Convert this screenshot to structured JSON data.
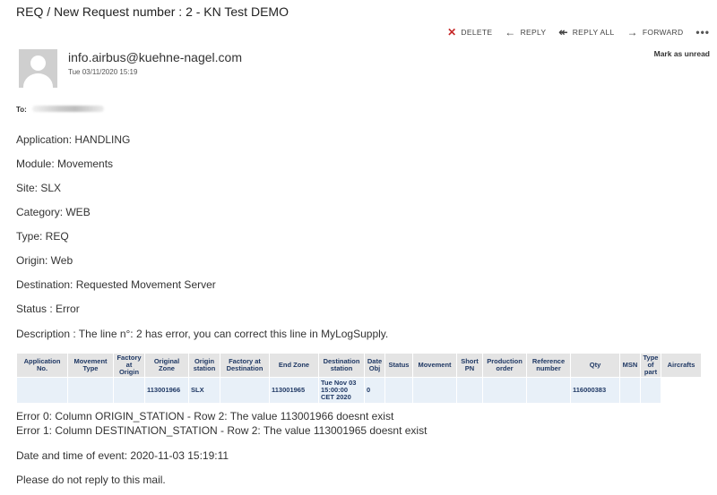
{
  "subject": "REQ / New Request number : 2 - KN Test DEMO",
  "actions": {
    "delete": "DELETE",
    "reply": "REPLY",
    "reply_all": "REPLY ALL",
    "forward": "FORWARD",
    "more": "•••",
    "mark_unread": "Mark as unread"
  },
  "sender": {
    "email": "info.airbus@kuehne-nagel.com",
    "date": "Tue 03/11/2020 15:19"
  },
  "to_label": "To:",
  "body": {
    "application": "Application: HANDLING",
    "module": "Module: Movements",
    "site": "Site: SLX",
    "category": "Category: WEB",
    "type": "Type: REQ",
    "origin": "Origin: Web",
    "destination": "Destination: Requested Movement Server",
    "status": "Status : Error",
    "description": "Description : The line n°: 2 has error, you can correct this line in MyLogSupply."
  },
  "table": {
    "headers": [
      "Application No.",
      "Movement Type",
      "Factory at Origin",
      "Original Zone",
      "Origin station",
      "Factory at Destination",
      "End Zone",
      "Destination station",
      "Date Obj",
      "Status",
      "Movement",
      "Short PN",
      "Production order",
      "Reference number",
      "Qty",
      "MSN",
      "Type of part",
      "Aircrafts"
    ],
    "rows": [
      [
        "",
        "",
        "",
        "113001966",
        "SLX",
        "",
        "113001965",
        "Tue Nov 03 15:00:00 CET 2020",
        "0",
        "",
        "",
        "",
        "",
        "",
        "116000383",
        "",
        "",
        ""
      ]
    ]
  },
  "errors": [
    "Error 0: Column ORIGIN_STATION - Row 2: The value 113001966 doesnt exist",
    "Error 1: Column DESTINATION_STATION - Row 2: The value 113001965 doesnt exist"
  ],
  "event_time": "Date and time of event: 2020-11-03 15:19:11",
  "footer": "Please do not reply to this mail.",
  "colors": {
    "delete_icon": "#c62828",
    "table_header_text": "#1f3864",
    "table_row_bg": "#e8f0f8",
    "avatar_bg": "#cfcfcf"
  },
  "icons": [
    "close-x-icon",
    "reply-arrow-icon",
    "reply-all-arrow-icon",
    "forward-arrow-icon",
    "more-dots-icon",
    "avatar-placeholder-icon"
  ]
}
